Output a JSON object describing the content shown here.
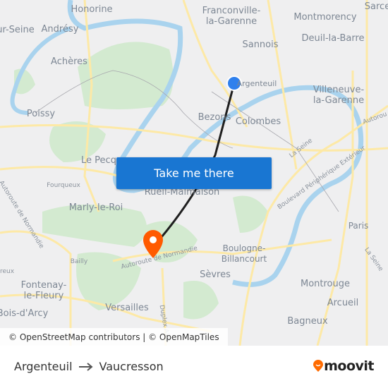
{
  "map": {
    "labels": [
      "Honorine",
      "Andrésy",
      "ur-Seine",
      "Achères",
      "Poissy",
      "Le Pecq",
      "Fourqueux",
      "Marly-le-Roi",
      "Bailly",
      "Fontenay-\nle-Fleury",
      "Bois-d'Arcy",
      "Versailles",
      "Sèvres",
      "Boulogne-\nBillancourt",
      "Rueil-Malmaison",
      "Bezons",
      "Colombes",
      "Argenteuil",
      "Sannois",
      "Franconville-\nla-Garenne",
      "Montmorency",
      "Deuil-la-Barre",
      "Villeneuve-\nla-Garenne",
      "Sarce",
      "Paris",
      "Montrouge",
      "Arcueil",
      "Bagneux",
      "reux"
    ],
    "road_labels": [
      "Autoroute de Normandie",
      "Autoroute de Normandie",
      "La Seine",
      "Boulevard Périphérique Extérieur",
      "Autorou",
      "La Seine",
      "Duplex A86"
    ],
    "origin_color": "#2f80ed",
    "destination_color": "#ff5a00",
    "route_color": "#1f1f1f"
  },
  "cta": {
    "label": "Take me there"
  },
  "attribution": "© OpenStreetMap contributors | © OpenMapTiles",
  "footer": {
    "from": "Argenteuil",
    "to": "Vaucresson",
    "arrow_icon": "arrow-right-icon",
    "brand": "moovit",
    "brand_color": "#ff6b00"
  }
}
